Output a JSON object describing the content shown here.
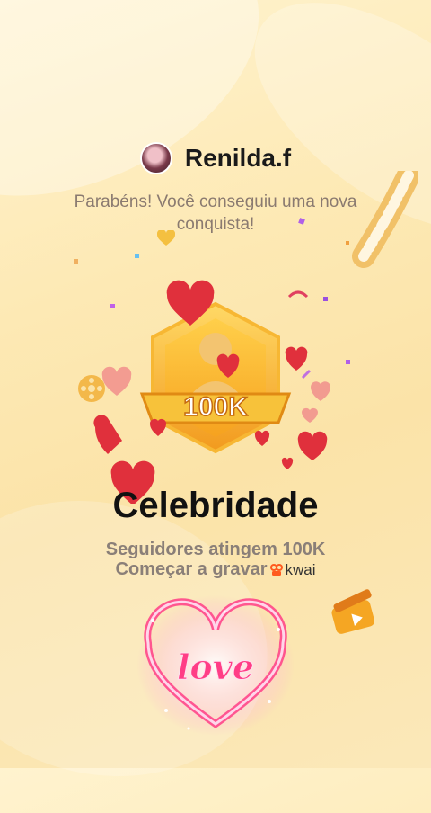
{
  "user": {
    "name": "Renilda.f"
  },
  "message": "Parabéns! Você conseguiu uma nova conquista!",
  "badge": {
    "value_label": "100K"
  },
  "achievement": {
    "title": "Celebridade",
    "description": "Seguidores atingem 100K",
    "cta": "Começar a gravar",
    "brand": "kwai"
  },
  "overlay_text": "love",
  "colors": {
    "background": "#fde9b4",
    "badge_gold": "#f7b733",
    "heart_red": "#e0303c",
    "text_dark": "#111111",
    "text_muted": "#8a7f78"
  },
  "icons": [
    "avatar",
    "trophy-badge",
    "heart-icon",
    "film-strip-icon",
    "film-reel-icon",
    "clapperboard-icon",
    "kwai-logo-icon",
    "love-heart-sticker"
  ]
}
